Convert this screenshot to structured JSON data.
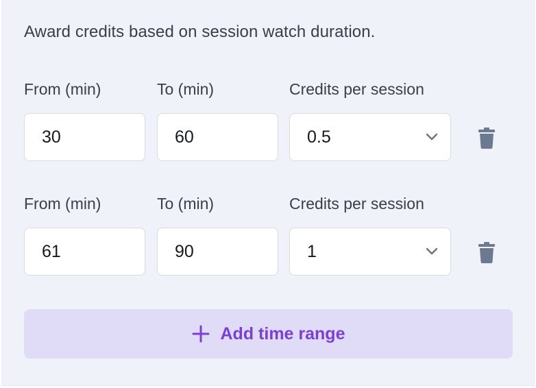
{
  "description": "Award credits based on session watch duration.",
  "labels": {
    "from": "From (min)",
    "to": "To (min)",
    "credits": "Credits per session"
  },
  "ranges": [
    {
      "from": "30",
      "to": "60",
      "credits": "0.5"
    },
    {
      "from": "61",
      "to": "90",
      "credits": "1"
    }
  ],
  "add_button_label": "Add time range",
  "icons": {
    "delete": "trash-icon",
    "dropdown": "chevron-down-icon",
    "add": "plus-icon"
  },
  "colors": {
    "panel_bg": "#eff2f8",
    "accent": "#7a3fd9",
    "accent_bg": "#e0dcf8",
    "trash": "#6b7a90"
  }
}
